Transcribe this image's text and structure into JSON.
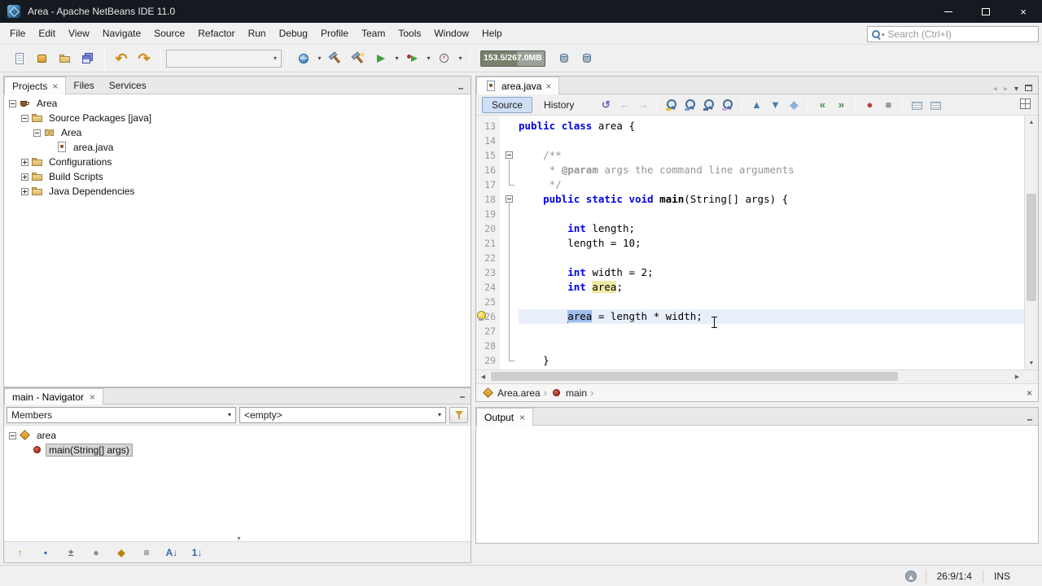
{
  "window": {
    "title": "Area - Apache NetBeans IDE 11.0"
  },
  "menubar": [
    "File",
    "Edit",
    "View",
    "Navigate",
    "Source",
    "Refactor",
    "Run",
    "Debug",
    "Profile",
    "Team",
    "Tools",
    "Window",
    "Help"
  ],
  "search": {
    "placeholder": "Search (Ctrl+I)"
  },
  "main_toolbar": {
    "file_buttons": [
      {
        "name": "new-file-button",
        "icon": "new-file-icon"
      },
      {
        "name": "new-project-button",
        "icon": "new-project-icon"
      },
      {
        "name": "open-project-button",
        "icon": "open-project-icon"
      },
      {
        "name": "save-all-button",
        "icon": "save-all-icon"
      }
    ],
    "edit_buttons": [
      {
        "name": "undo-button",
        "glyph": "↶",
        "color": "#cb8c1d"
      },
      {
        "name": "redo-button",
        "glyph": "↷",
        "color": "#cb8c1d"
      }
    ],
    "config_combo_value": "",
    "run_buttons": [
      {
        "name": "set-project-configuration-button",
        "icon": "globe-icon",
        "dropdown": true
      },
      {
        "name": "build-project-button",
        "icon": "hammer-icon"
      },
      {
        "name": "clean-and-build-project-button",
        "icon": "hammer-broom-icon"
      },
      {
        "name": "run-project-button",
        "icon": "run-icon",
        "dropdown": true
      },
      {
        "name": "debug-project-button",
        "icon": "debug-icon",
        "dropdown": true
      },
      {
        "name": "profile-project-button",
        "icon": "profile-icon",
        "dropdown": true
      }
    ],
    "memory": "153.5/267.0MB",
    "gc_buttons": [
      {
        "name": "gc-button-1",
        "icon": "database-icon"
      },
      {
        "name": "gc-button-2",
        "icon": "database-icon"
      }
    ]
  },
  "projects_panel": {
    "tabs": [
      {
        "label": "Projects",
        "active": true,
        "closable": true
      },
      {
        "label": "Files",
        "active": false,
        "closable": false
      },
      {
        "label": "Services",
        "active": false,
        "closable": false
      }
    ],
    "tree": [
      {
        "label": "Area",
        "level": 0,
        "icon": "project-icon",
        "handle": "minus"
      },
      {
        "label": "Source Packages [java]",
        "level": 1,
        "icon": "source-packages-icon",
        "handle": "minus"
      },
      {
        "label": "Area",
        "level": 2,
        "icon": "package-icon",
        "handle": "minus"
      },
      {
        "label": "area.java",
        "level": 3,
        "icon": "java-file-icon",
        "handle": "none"
      },
      {
        "label": "Configurations",
        "level": 1,
        "icon": "config-folder-icon",
        "handle": "plus"
      },
      {
        "label": "Build Scripts",
        "level": 1,
        "icon": "folder-icon",
        "handle": "plus"
      },
      {
        "label": "Java Dependencies",
        "level": 1,
        "icon": "libraries-icon",
        "handle": "plus"
      }
    ]
  },
  "navigator": {
    "title": "main - Navigator",
    "members_combo": "Members",
    "filter_combo": "<empty>",
    "tree": [
      {
        "label": "area",
        "level": 0,
        "icon": "class-icon",
        "handle": "minus",
        "selected": false
      },
      {
        "label": "main(String[] args)",
        "level": 1,
        "icon": "method-icon",
        "handle": "none",
        "selected": true
      }
    ],
    "filters": [
      {
        "name": "show-inherited-members-button",
        "glyph": "↑",
        "color": "#b8860b"
      },
      {
        "name": "show-fields-button",
        "glyph": "▪",
        "color": "#3465a4"
      },
      {
        "name": "show-static-members-button",
        "glyph": "±",
        "color": "#666666"
      },
      {
        "name": "show-non-public-button",
        "glyph": "●",
        "color": "#8a8a8a"
      },
      {
        "name": "show-inner-classes-button",
        "glyph": "◆",
        "color": "#b8860b"
      },
      {
        "name": "fully-qualified-names-button",
        "glyph": "≡",
        "color": "#555555"
      },
      {
        "name": "sort-alphabetically-button",
        "glyph": "A↓",
        "color": "#3465a4"
      },
      {
        "name": "sort-by-source-button",
        "glyph": "1↓",
        "color": "#3465a4"
      }
    ]
  },
  "editor": {
    "tab": "area.java",
    "views": [
      {
        "label": "Source",
        "active": true
      },
      {
        "label": "History",
        "active": false
      }
    ],
    "toolbar": [
      {
        "name": "last-edit-icon",
        "glyph": "↺",
        "color": "#7a5fb5"
      },
      {
        "name": "back-icon",
        "glyph": "←",
        "color": "#b9b9b9"
      },
      {
        "name": "forward-icon",
        "glyph": "→",
        "color": "#b9b9b9"
      },
      {
        "sep": true
      },
      {
        "name": "find-selection-icon",
        "kind": "mag",
        "accent": "#e6c431"
      },
      {
        "name": "find-previous-icon",
        "kind": "mag",
        "accent": "#7ba3d0"
      },
      {
        "name": "find-next-icon",
        "kind": "mag",
        "accent": "#3f6fae"
      },
      {
        "name": "toggle-highlight-icon",
        "kind": "mag",
        "accent": "#d8a9df"
      },
      {
        "sep": true
      },
      {
        "name": "previous-bookmark-icon",
        "glyph": "▲",
        "color": "#4c7ab0"
      },
      {
        "name": "next-bookmark-icon",
        "glyph": "▼",
        "color": "#4c7ab0"
      },
      {
        "name": "toggle-bookmark-icon",
        "glyph": "◆",
        "color": "#8fb0d6"
      },
      {
        "sep": true
      },
      {
        "name": "shift-line-left-icon",
        "glyph": "«",
        "color": "#4c8a4c"
      },
      {
        "name": "shift-line-right-icon",
        "glyph": "»",
        "color": "#4c8a4c"
      },
      {
        "sep": true
      },
      {
        "name": "start-macro-recording-icon",
        "glyph": "●",
        "color": "#c23b3b"
      },
      {
        "name": "stop-macro-recording-icon",
        "glyph": "■",
        "color": "#9a9a9a"
      },
      {
        "sep": true
      },
      {
        "name": "comment-icon",
        "kind": "cmt"
      },
      {
        "name": "uncomment-icon",
        "kind": "cmt"
      }
    ],
    "breadcrumb": [
      {
        "label": "Area.area",
        "icon": "class-icon"
      },
      {
        "label": "main",
        "icon": "method-icon"
      }
    ],
    "lines": [
      {
        "n": 13,
        "fold": "nofold",
        "tokens": [
          [
            "k",
            "public"
          ],
          [
            "p",
            " "
          ],
          [
            "k",
            "class"
          ],
          [
            "p",
            " area {"
          ]
        ]
      },
      {
        "n": 14,
        "fold": "nofold",
        "tokens": []
      },
      {
        "n": 15,
        "fold": "box",
        "tokens": [
          [
            "c",
            "    /**"
          ]
        ]
      },
      {
        "n": 16,
        "fold": "line",
        "tokens": [
          [
            "c",
            "     * "
          ],
          [
            "j",
            "@param"
          ],
          [
            "c",
            " args the command line arguments"
          ]
        ]
      },
      {
        "n": 17,
        "fold": "end",
        "tokens": [
          [
            "c",
            "     */"
          ]
        ]
      },
      {
        "n": 18,
        "fold": "box",
        "tokens": [
          [
            "p",
            "    "
          ],
          [
            "k",
            "public"
          ],
          [
            "p",
            " "
          ],
          [
            "k",
            "static"
          ],
          [
            "p",
            " "
          ],
          [
            "k",
            "void"
          ],
          [
            "p",
            " "
          ],
          [
            "m",
            "main"
          ],
          [
            "p",
            "(String[] args) {"
          ]
        ]
      },
      {
        "n": 19,
        "fold": "line",
        "tokens": []
      },
      {
        "n": 20,
        "fold": "line",
        "tokens": [
          [
            "p",
            "        "
          ],
          [
            "k",
            "int"
          ],
          [
            "p",
            " length;"
          ]
        ]
      },
      {
        "n": 21,
        "fold": "line",
        "tokens": [
          [
            "p",
            "        length = "
          ],
          [
            "n",
            "10"
          ],
          [
            "p",
            ";"
          ]
        ]
      },
      {
        "n": 22,
        "fold": "line",
        "tokens": []
      },
      {
        "n": 23,
        "fold": "line",
        "tokens": [
          [
            "p",
            "        "
          ],
          [
            "k",
            "int"
          ],
          [
            "p",
            " width = "
          ],
          [
            "n",
            "2"
          ],
          [
            "p",
            ";"
          ]
        ]
      },
      {
        "n": 24,
        "fold": "line",
        "tokens": [
          [
            "p",
            "        "
          ],
          [
            "k",
            "int"
          ],
          [
            "p",
            " "
          ],
          [
            "o",
            "area"
          ],
          [
            "p",
            ";"
          ]
        ]
      },
      {
        "n": 25,
        "fold": "line",
        "tokens": []
      },
      {
        "n": 26,
        "fold": "line",
        "current": true,
        "bulb": true,
        "tokens": [
          [
            "p",
            "        "
          ],
          [
            "caret",
            ""
          ],
          [
            "s",
            "area"
          ],
          [
            "p",
            " = length * width;"
          ]
        ]
      },
      {
        "n": 27,
        "fold": "line",
        "tokens": []
      },
      {
        "n": 28,
        "fold": "line",
        "tokens": []
      },
      {
        "n": 29,
        "fold": "end",
        "tokens": [
          [
            "p",
            "    }"
          ]
        ]
      }
    ]
  },
  "output": {
    "tab": "Output"
  },
  "statusbar": {
    "caret": "26:9/1:4",
    "mode": "INS"
  }
}
